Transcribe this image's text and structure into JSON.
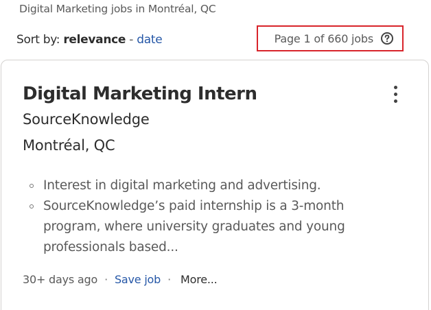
{
  "results_heading": "Digital Marketing jobs in Montréal, QC",
  "sort": {
    "label": "Sort by:",
    "active": "relevance",
    "separator": "-",
    "alternate": "date"
  },
  "pagination": {
    "text": "Page 1 of 660 jobs",
    "help_icon": "question-circle-icon"
  },
  "job": {
    "title": "Digital Marketing Intern",
    "company": "SourceKnowledge",
    "location": "Montréal, QC",
    "menu_icon": "kebab-menu-icon",
    "snippet": [
      "Interest in digital marketing and advertising.",
      "SourceKnowledge’s paid internship is a 3-month program, where university graduates and young professionals based..."
    ],
    "posted": "30+ days ago",
    "save_label": "Save job",
    "more_label": "More..."
  },
  "colors": {
    "link": "#2557a7",
    "highlight_border": "#d8232a",
    "text": "#2d2d2d",
    "muted": "#595959"
  }
}
